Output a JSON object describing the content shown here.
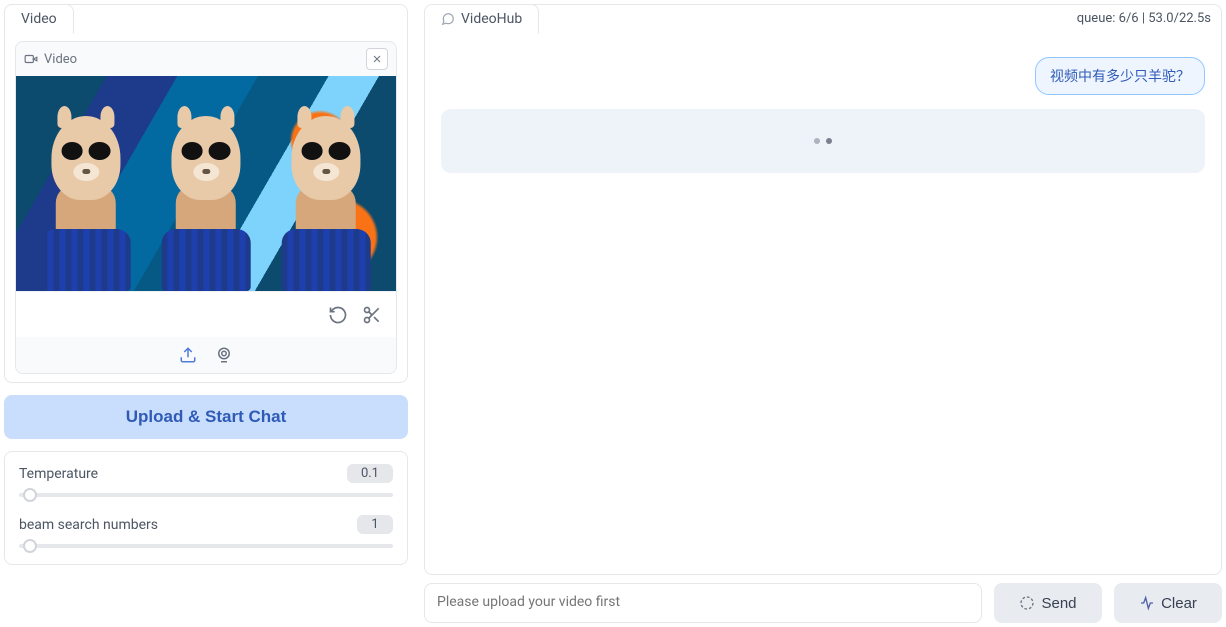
{
  "left": {
    "tab_label": "Video",
    "inner_label": "Video",
    "upload_button": "Upload & Start Chat",
    "params": {
      "temperature": {
        "label": "Temperature",
        "value": "0.1",
        "thumb_pct": 3
      },
      "beam": {
        "label": "beam search numbers",
        "value": "1",
        "thumb_pct": 3
      }
    }
  },
  "chat": {
    "tab_label": "VideoHub",
    "queue_status": "queue: 6/6 | 53.0/22.5s",
    "user_message": "视频中有多少只羊驼？",
    "input_placeholder": "Please upload your video first",
    "send_label": "Send",
    "clear_label": "Clear"
  }
}
